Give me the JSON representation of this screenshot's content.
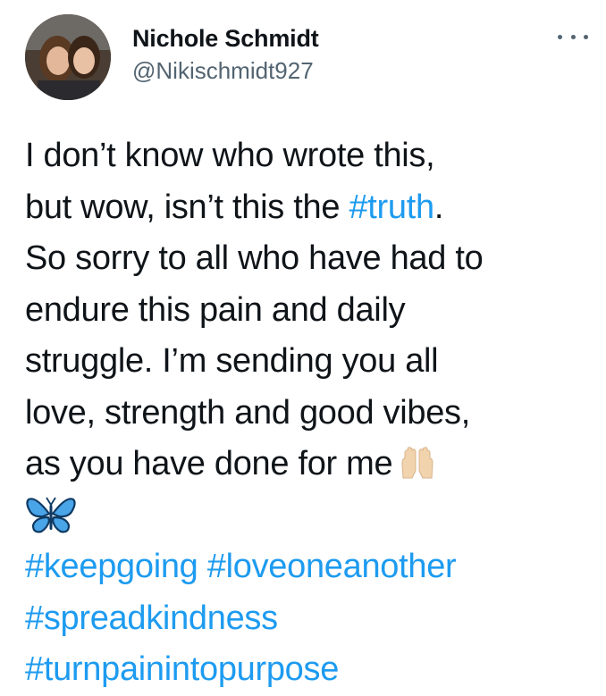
{
  "author": {
    "display_name": "Nichole Schmidt",
    "handle": "@Nikischmidt927",
    "avatar_icon": "avatar-photo"
  },
  "menu": {
    "more_icon": "more-horizontal-icon"
  },
  "tweet": {
    "line1": "I don’t know who wrote this,",
    "line2_pre": "but wow, isn’t this the ",
    "line2_tag": "#truth",
    "line2_post": ".",
    "line3": "So sorry to all who have had to",
    "line4": "endure this pain and daily",
    "line5": "struggle. I’m sending you all",
    "line6": "love, strength and good vibes,",
    "line7": "as you have done for me",
    "emoji_1": "raising-hands-emoji",
    "emoji_2": "butterfly-emoji",
    "hashtags": {
      "keepgoing": "#keepgoing",
      "loveoneanother": "#loveoneanother",
      "spreadkindness": "#spreadkindness",
      "turnpainintopurpose": "#turnpainintopurpose"
    }
  },
  "colors": {
    "text": "#0f1419",
    "secondary": "#536471",
    "link": "#1d9bf0"
  }
}
